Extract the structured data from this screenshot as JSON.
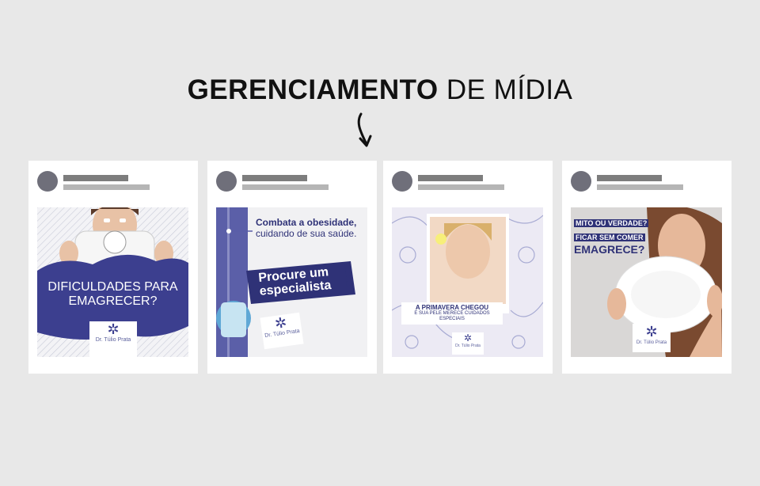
{
  "page": {
    "title_bold": "GERENCIAMENTO",
    "title_light": "DE MÍDIA"
  },
  "colors": {
    "background": "#e8e8e8",
    "brand_blue": "#3c3f8f",
    "card": "#ffffff"
  },
  "cards": [
    {
      "name": "post-emagrecer",
      "headline": "DIFICULDADES PARA EMAGRECER?",
      "line1": "DIFICULDADES PARA",
      "line2": "EMAGRECER?",
      "logo_name": "Dr. Túlio Prata"
    },
    {
      "name": "post-obesidade",
      "line1": "Combata a obesidade,",
      "line2": "cuidando de sua saúde.",
      "banner1": "Procure um",
      "banner2": "especialista",
      "exclaim": "!",
      "logo_name": "Dr. Túlio Prata"
    },
    {
      "name": "post-primavera",
      "line1": "A PRIMAVERA CHEGOU",
      "line2": "E SUA PELE MERECE CUIDADOS",
      "line3": "ESPECIAIS",
      "logo_name": "Dr. Túlio Prata"
    },
    {
      "name": "post-mito",
      "line1": "MITO OU VERDADE?",
      "line2": "FICAR SEM COMER",
      "line3": "EMAGRECE?",
      "logo_name": "Dr. Túlio Prata"
    }
  ],
  "icons": {
    "logo": "star-logo-icon",
    "arrow": "arrow-down-icon"
  }
}
